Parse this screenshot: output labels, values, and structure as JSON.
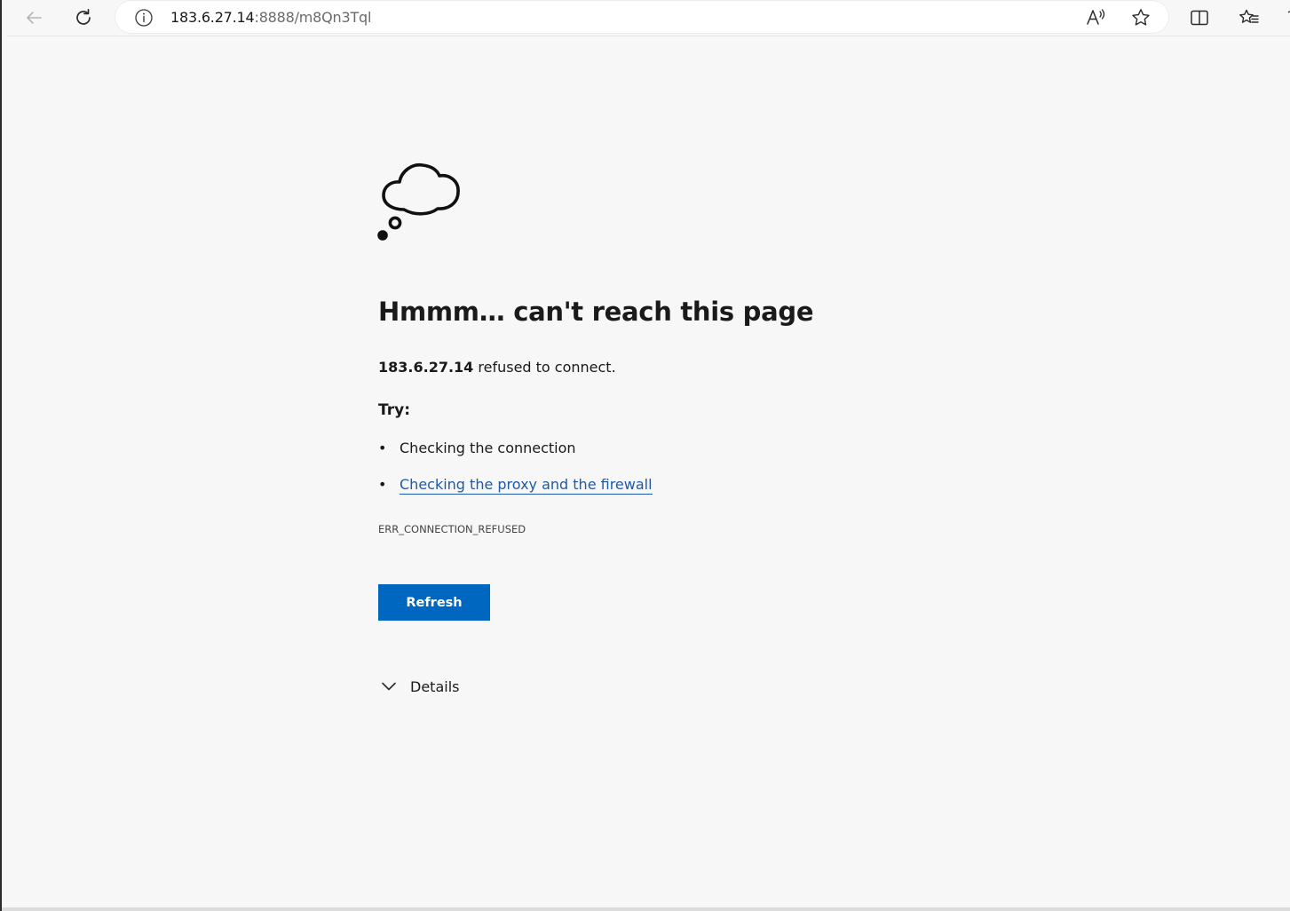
{
  "browser": {
    "address": {
      "url_host": "183.6.27.14",
      "url_rest": ":8888/m8Qn3Tql"
    },
    "icons": {
      "back": "back-arrow-icon",
      "reload": "reload-icon",
      "site_info": "info-icon",
      "read_aloud": "read-aloud-icon",
      "favorite": "star-icon",
      "split_screen": "split-screen-icon",
      "favorites": "favorites-list-icon"
    }
  },
  "error_page": {
    "heading": "Hmmm… can't reach this page",
    "host": "183.6.27.14",
    "refused_text": " refused to connect.",
    "try_label": "Try:",
    "suggestions": [
      {
        "text": "Checking the connection",
        "is_link": false
      },
      {
        "text": "Checking the proxy and the firewall",
        "is_link": true
      }
    ],
    "bullet": "•",
    "error_code": "ERR_CONNECTION_REFUSED",
    "refresh_label": "Refresh",
    "details_label": "Details"
  },
  "colors": {
    "accent": "#0067c0",
    "link": "#1f5aa6",
    "background": "#f7f7f7"
  }
}
